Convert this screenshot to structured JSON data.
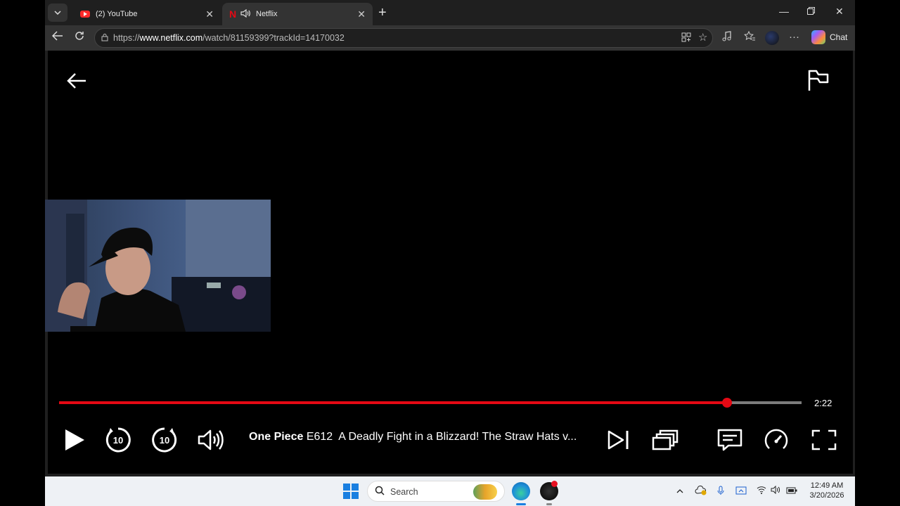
{
  "browser": {
    "tabs": [
      {
        "title": "(2) YouTube",
        "favicon": "youtube-icon",
        "active": false
      },
      {
        "title": "Netflix",
        "favicon": "netflix-icon",
        "active": true,
        "audio_playing": true
      }
    ],
    "address_bar": {
      "url_prefix": "https://",
      "url_domain": "www.netflix.com",
      "url_path": "/watch/81159399?trackId=14170032"
    },
    "chat_label": "Chat"
  },
  "player": {
    "progress_fraction": 0.9,
    "time_remaining": "2:22",
    "show_title": "One Piece",
    "episode_code": "E612",
    "episode_title": "A Deadly Fight in a Blizzard! The Straw Hats v...",
    "accent_color": "#e50914"
  },
  "taskbar": {
    "search_placeholder": "Search",
    "clock_time": "12:49 AM",
    "clock_date": "3/20/2026"
  }
}
